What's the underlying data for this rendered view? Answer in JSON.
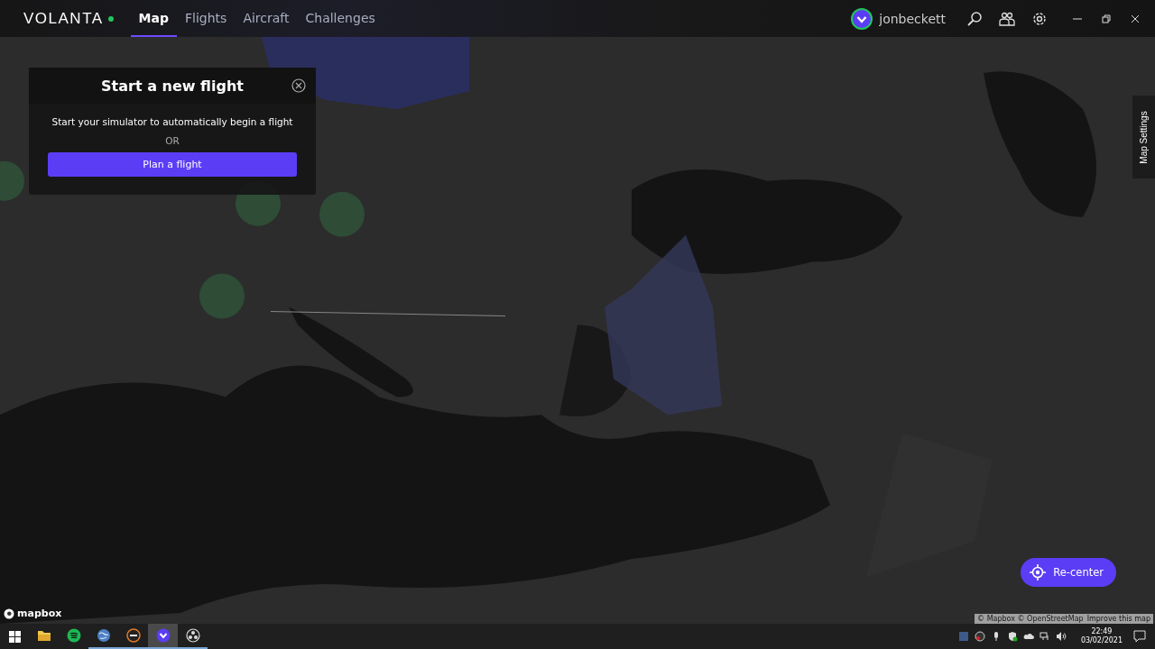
{
  "app": {
    "logo": "VOLANTA",
    "online": true
  },
  "nav": [
    {
      "label": "Map",
      "selected": true
    },
    {
      "label": "Flights",
      "selected": false
    },
    {
      "label": "Aircraft",
      "selected": false
    },
    {
      "label": "Challenges",
      "selected": false
    }
  ],
  "user": {
    "name": "jonbeckett"
  },
  "start_panel": {
    "title": "Start a new flight",
    "message": "Start your simulator to automatically begin a flight",
    "separator": "OR",
    "button": "Plan a flight"
  },
  "map_settings": {
    "label": "Map Settings"
  },
  "recenter": {
    "label": "Re-center"
  },
  "attribution": {
    "logo": "mapbox",
    "credits": "© Mapbox © OpenStreetMap",
    "link": "Improve this map"
  },
  "taskbar": {
    "apps": [
      {
        "kind": "explorer",
        "running": false,
        "selected": false
      },
      {
        "kind": "spotify",
        "running": false,
        "selected": false
      },
      {
        "kind": "globe",
        "running": true,
        "selected": false
      },
      {
        "kind": "p3d",
        "running": true,
        "selected": false
      },
      {
        "kind": "volanta",
        "running": true,
        "selected": true
      },
      {
        "kind": "obs",
        "running": true,
        "selected": false
      }
    ],
    "time": "22:49",
    "date": "03/02/2021"
  }
}
